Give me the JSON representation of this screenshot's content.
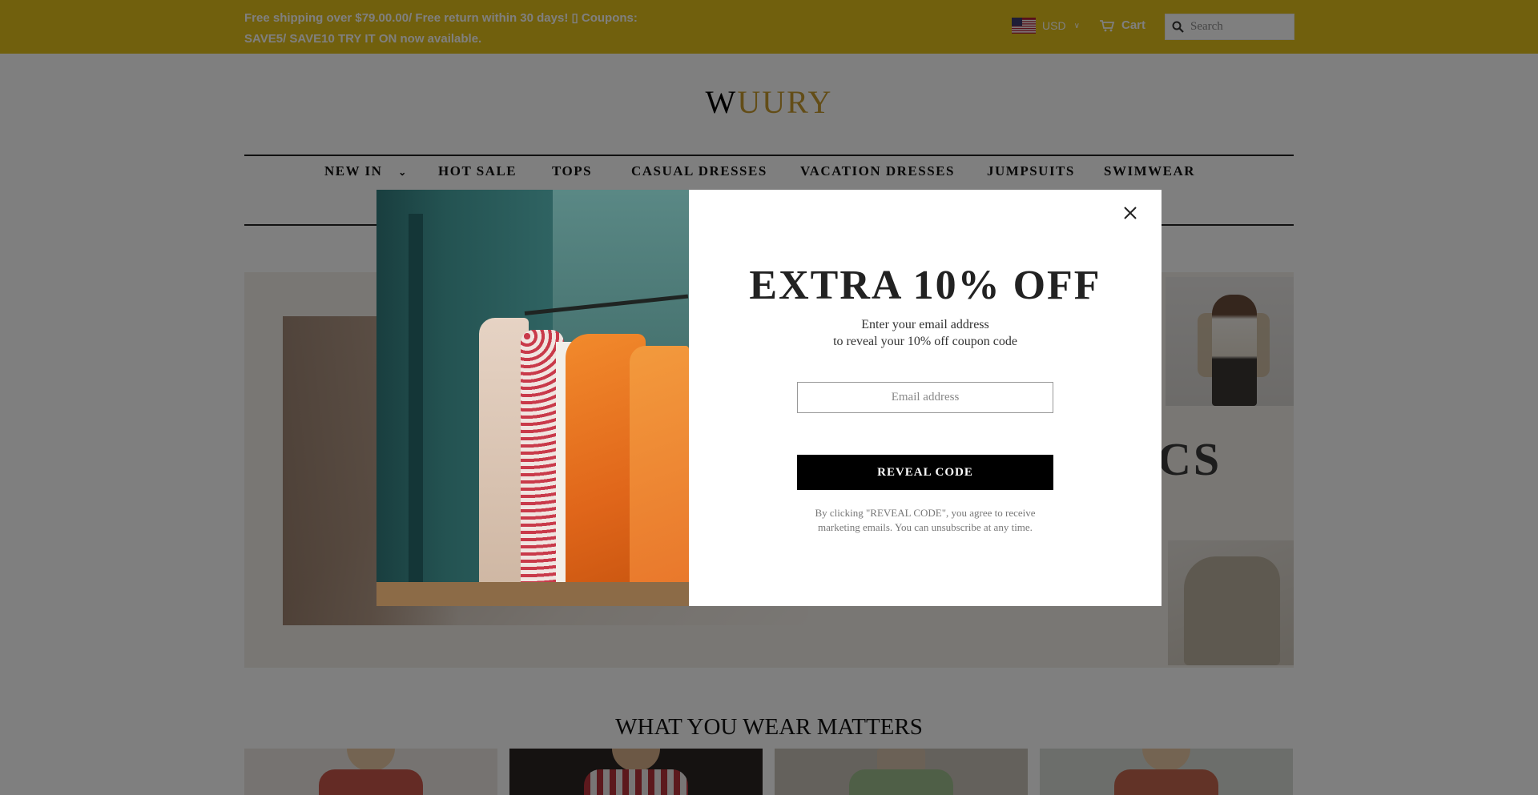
{
  "announcement": {
    "text": "Free shipping over $79.00.00/ Free return within 30 days! ▯ Coupons: SAVE5/ SAVE10 TRY IT ON now available."
  },
  "header": {
    "currency": "USD",
    "currency_flag_icon": "us-flag-icon",
    "cart_label": "Cart",
    "search_placeholder": "Search"
  },
  "logo": {
    "part1": "W",
    "part2": "UURY"
  },
  "nav": {
    "items": [
      {
        "label": "NEW IN",
        "has_dropdown": true
      },
      {
        "label": "HOT SALE"
      },
      {
        "label": "TOPS"
      },
      {
        "label": "CASUAL DRESSES"
      },
      {
        "label": "VACATION DRESSES"
      },
      {
        "label": "JUMPSUITS"
      },
      {
        "label": "SWIMWEAR"
      }
    ]
  },
  "hero": {
    "visible_text": "CS"
  },
  "section": {
    "title": "WHAT YOU WEAR MATTERS"
  },
  "popup": {
    "title": "EXTRA 10% OFF",
    "subtitle_line1": "Enter your email address",
    "subtitle_line2": "to reveal your 10% off coupon code",
    "email_placeholder": "Email address",
    "button_label": "REVEAL CODE",
    "disclaimer": "By clicking \"REVEAL CODE\", you agree to receive marketing emails. You can unsubscribe at any time."
  },
  "colors": {
    "topbar": "#e2c01a",
    "logo_accent": "#c79a2e",
    "button": "#000000"
  }
}
